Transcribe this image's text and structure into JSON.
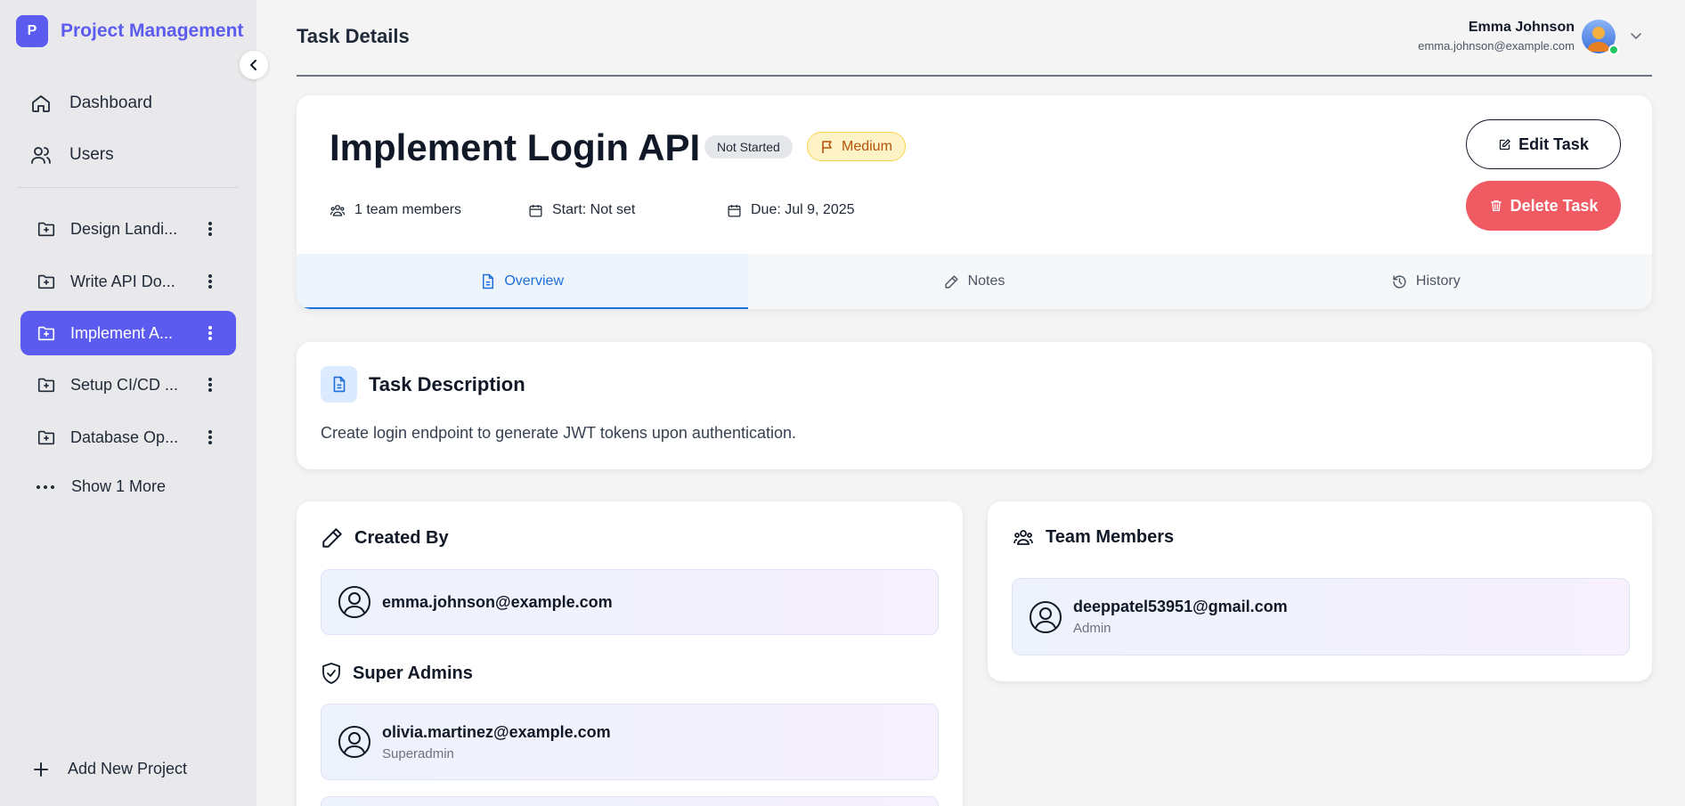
{
  "app": {
    "title": "Project Management",
    "logo_letter": "P"
  },
  "sidebar": {
    "nav": [
      {
        "label": "Dashboard",
        "icon": "home-icon"
      },
      {
        "label": "Users",
        "icon": "users-icon"
      }
    ],
    "projects": [
      {
        "label": "Design Landi...",
        "active": false
      },
      {
        "label": "Write API Do...",
        "active": false
      },
      {
        "label": "Implement A...",
        "active": true
      },
      {
        "label": "Setup CI/CD ...",
        "active": false
      },
      {
        "label": "Database Op...",
        "active": false
      }
    ],
    "show_more": "Show 1 More",
    "add_project": "Add New Project"
  },
  "header": {
    "title": "Task Details",
    "user": {
      "name": "Emma Johnson",
      "email": "emma.johnson@example.com"
    }
  },
  "task": {
    "title": "Implement Login API",
    "status": "Not Started",
    "priority": "Medium",
    "team_count": "1 team members",
    "start": "Start: Not set",
    "due": "Due: Jul 9, 2025",
    "edit_label": "Edit Task",
    "delete_label": "Delete Task"
  },
  "tabs": [
    {
      "label": "Overview",
      "active": true
    },
    {
      "label": "Notes",
      "active": false
    },
    {
      "label": "History",
      "active": false
    }
  ],
  "description": {
    "title": "Task Description",
    "text": "Create login endpoint to generate JWT tokens upon authentication."
  },
  "created_by": {
    "title": "Created By",
    "email": "emma.johnson@example.com"
  },
  "super_admins": {
    "title": "Super Admins",
    "items": [
      {
        "email": "olivia.martinez@example.com",
        "role": "Superadmin"
      }
    ]
  },
  "team_members": {
    "title": "Team Members",
    "items": [
      {
        "email": "deeppatel53951@gmail.com",
        "role": "Admin"
      }
    ]
  },
  "colors": {
    "accent": "#5b5bf0",
    "danger": "#f05a63",
    "tab_active": "#1d6fdc",
    "priority_bg": "#fef3c7"
  }
}
